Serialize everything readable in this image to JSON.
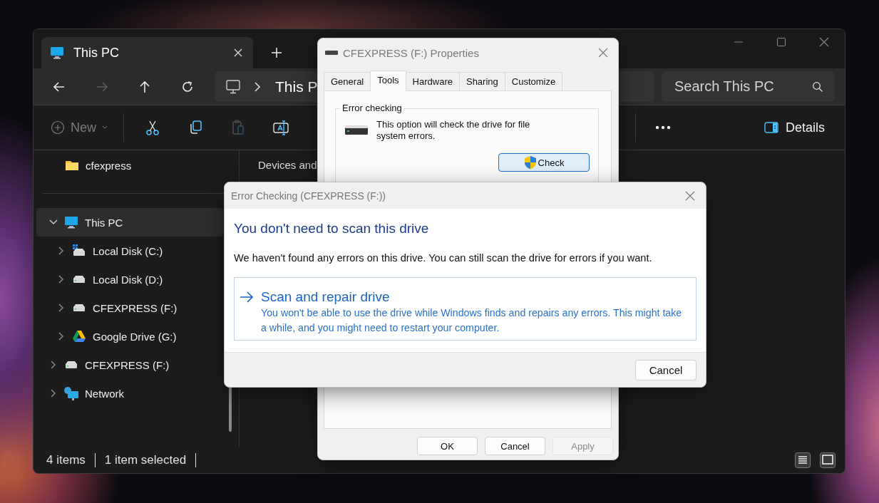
{
  "explorer": {
    "tabs": [
      {
        "label": "This PC",
        "selected": true
      }
    ],
    "nav_buttons": [
      {
        "kind": "back",
        "disabled": false
      },
      {
        "kind": "forward",
        "disabled": true
      },
      {
        "kind": "up",
        "disabled": false
      },
      {
        "kind": "refresh",
        "disabled": false
      }
    ],
    "address": {
      "crumb": "This P"
    },
    "search": {
      "placeholder": "Search This PC"
    },
    "toolbar": [
      {
        "kind": "new",
        "label": "New",
        "disabled": true
      },
      {
        "kind": "cut",
        "disabled": false
      },
      {
        "kind": "copy",
        "disabled": false
      },
      {
        "kind": "paste",
        "disabled": true
      },
      {
        "kind": "rename",
        "disabled": false
      }
    ],
    "details_button": {
      "label": "Details"
    },
    "sidebar": {
      "pinned": [
        {
          "label": "cfexpress",
          "kind": "folder"
        }
      ],
      "tree": [
        {
          "label": "This PC",
          "kind": "pc",
          "expanded": true,
          "selected": true,
          "children": [
            {
              "label": "Local Disk (C:)",
              "kind": "os_drive",
              "expanded": false,
              "selected": false
            },
            {
              "label": "Local Disk (D:)",
              "kind": "drive",
              "expanded": false,
              "selected": false
            },
            {
              "label": "CFEXPRESS (F:)",
              "kind": "drive",
              "expanded": false,
              "selected": false
            },
            {
              "label": "Google Drive (G:)",
              "kind": "cloud_drive",
              "expanded": false,
              "selected": false
            }
          ]
        },
        {
          "label": "CFEXPRESS (F:)",
          "kind": "drive",
          "expanded": false,
          "selected": false
        },
        {
          "label": "Network",
          "kind": "network",
          "expanded": false,
          "selected": false
        }
      ]
    },
    "content": {
      "group_header": "Devices and"
    },
    "status_bar": {
      "items": [
        "4 items",
        "1 item selected"
      ]
    }
  },
  "properties_dialog": {
    "title": "CFEXPRESS (F:) Properties",
    "tabs": [
      {
        "label": "General",
        "selected": false
      },
      {
        "label": "Tools",
        "selected": true
      },
      {
        "label": "Hardware",
        "selected": false
      },
      {
        "label": "Sharing",
        "selected": false
      },
      {
        "label": "Customize",
        "selected": false
      }
    ],
    "group_title": "Error checking",
    "description": "This option will check the drive for file system errors.",
    "check_button": "Check",
    "buttons": [
      {
        "label": "OK",
        "disabled": false
      },
      {
        "label": "Cancel",
        "disabled": false
      },
      {
        "label": "Apply",
        "disabled": true
      }
    ]
  },
  "error_dialog": {
    "title": "Error Checking (CFEXPRESS (F:))",
    "heading": "You don't need to scan this drive",
    "message": "We haven't found any errors on this drive. You can still scan the drive for errors if you want.",
    "option": {
      "title": "Scan and repair drive",
      "description": "You won't be able to use the drive while Windows finds and repairs any errors. This might take a while, and you might need to restart your computer."
    },
    "cancel_button": "Cancel"
  }
}
